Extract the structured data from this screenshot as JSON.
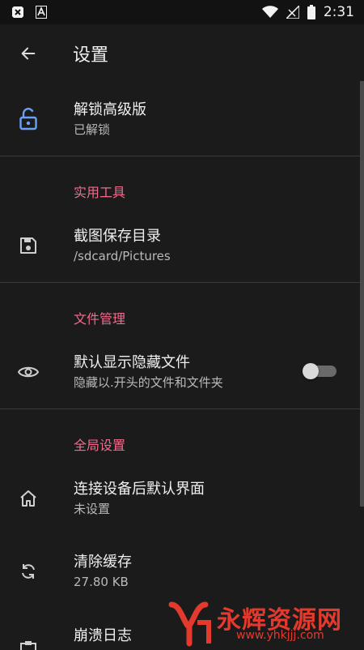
{
  "status_bar": {
    "time": "2:31",
    "icons": [
      "close-box-icon",
      "font-a-icon",
      "wifi-icon",
      "signal-icon",
      "battery-icon"
    ]
  },
  "app_bar": {
    "back_icon": "arrow-left-icon",
    "title": "设置"
  },
  "items": {
    "unlock": {
      "icon": "unlock-icon",
      "title": "解锁高级版",
      "subtitle": "已解锁"
    },
    "screenshot_dir": {
      "icon": "save-icon",
      "title": "截图保存目录",
      "subtitle": "/sdcard/Pictures"
    },
    "show_hidden": {
      "icon": "eye-icon",
      "title": "默认显示隐藏文件",
      "subtitle": "隐藏以.开头的文件和文件夹",
      "toggle_on": false
    },
    "default_screen": {
      "icon": "home-icon",
      "title": "连接设备后默认界面",
      "subtitle": "未设置"
    },
    "clear_cache": {
      "icon": "sync-icon",
      "title": "清除缓存",
      "subtitle": "27.80 KB"
    },
    "crash_log": {
      "icon": "clipboard-icon",
      "title": "崩溃日志"
    }
  },
  "sections": {
    "tools": "实用工具",
    "file_management": "文件管理",
    "global": "全局设置"
  },
  "watermark": {
    "text": "永辉资源网",
    "url": "www.yhkjjj.com"
  },
  "colors": {
    "accent": "#f36b8c",
    "unlock_icon": "#6aa0f7",
    "background": "#1b1b1b",
    "watermark": "#e43a2d"
  }
}
